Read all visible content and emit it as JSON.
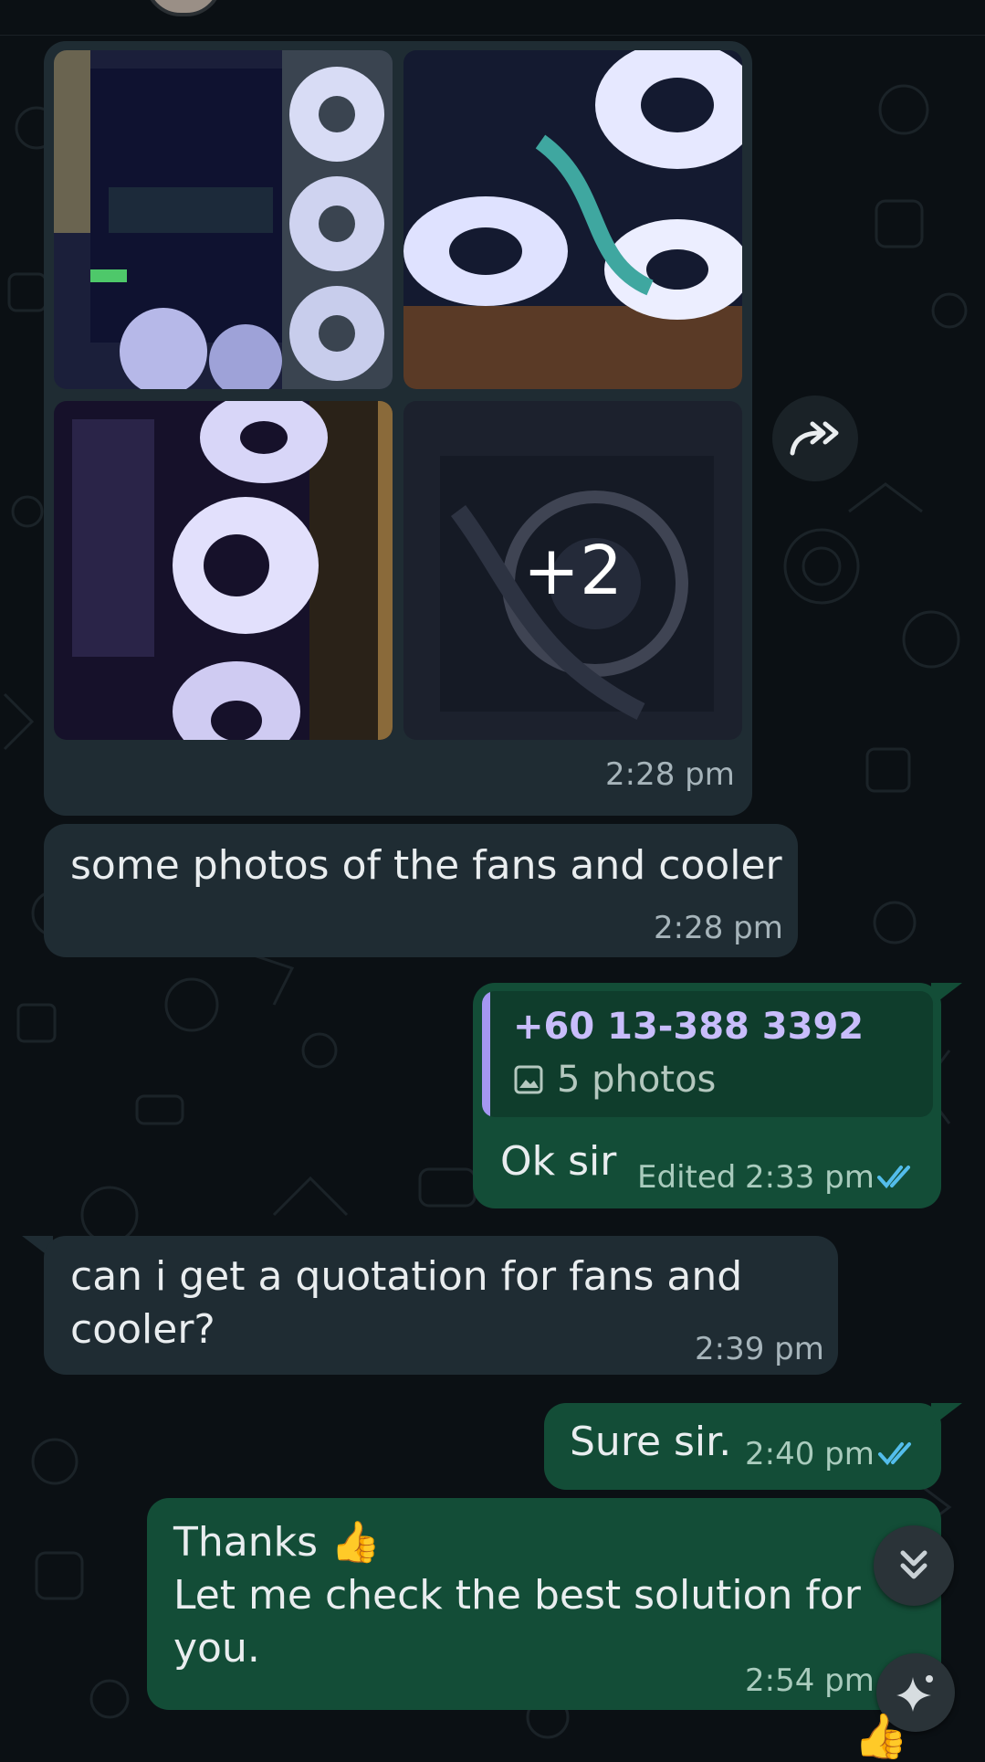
{
  "header": {
    "avatar": "contact-avatar"
  },
  "album": {
    "more_count": "+2",
    "time": "2:28 pm",
    "forward_icon": "forward-icon"
  },
  "messages": [
    {
      "id": "m1",
      "direction": "incoming",
      "text": "some photos of the fans and cooler",
      "time": "2:28 pm"
    },
    {
      "id": "m2",
      "direction": "outgoing",
      "quoted": {
        "sender": "+60 13-388 3392",
        "preview": "5 photos",
        "icon": "image-icon"
      },
      "text": "Ok sir",
      "edited_label": "Edited",
      "time": "2:33 pm",
      "status": "read"
    },
    {
      "id": "m3",
      "direction": "incoming",
      "text": "can i get a quotation for fans and\ncooler?",
      "time": "2:39 pm"
    },
    {
      "id": "m4",
      "direction": "outgoing",
      "text": "Sure sir.",
      "time": "2:40 pm",
      "status": "read"
    },
    {
      "id": "m5",
      "direction": "outgoing",
      "text": "Thanks 👍\nLet me check the best solution for\nyou.",
      "time": "2:54 pm"
    }
  ],
  "floating": {
    "scroll_down_icon": "double-chevron-down-icon",
    "ai_icon": "sparkle-icon",
    "reaction_emoji": "👍"
  },
  "colors": {
    "background": "#0b1014",
    "incoming": "#1f2c33",
    "outgoing": "#134d37",
    "read_ticks": "#53bdeb",
    "quote_bar": "#a497f2"
  }
}
